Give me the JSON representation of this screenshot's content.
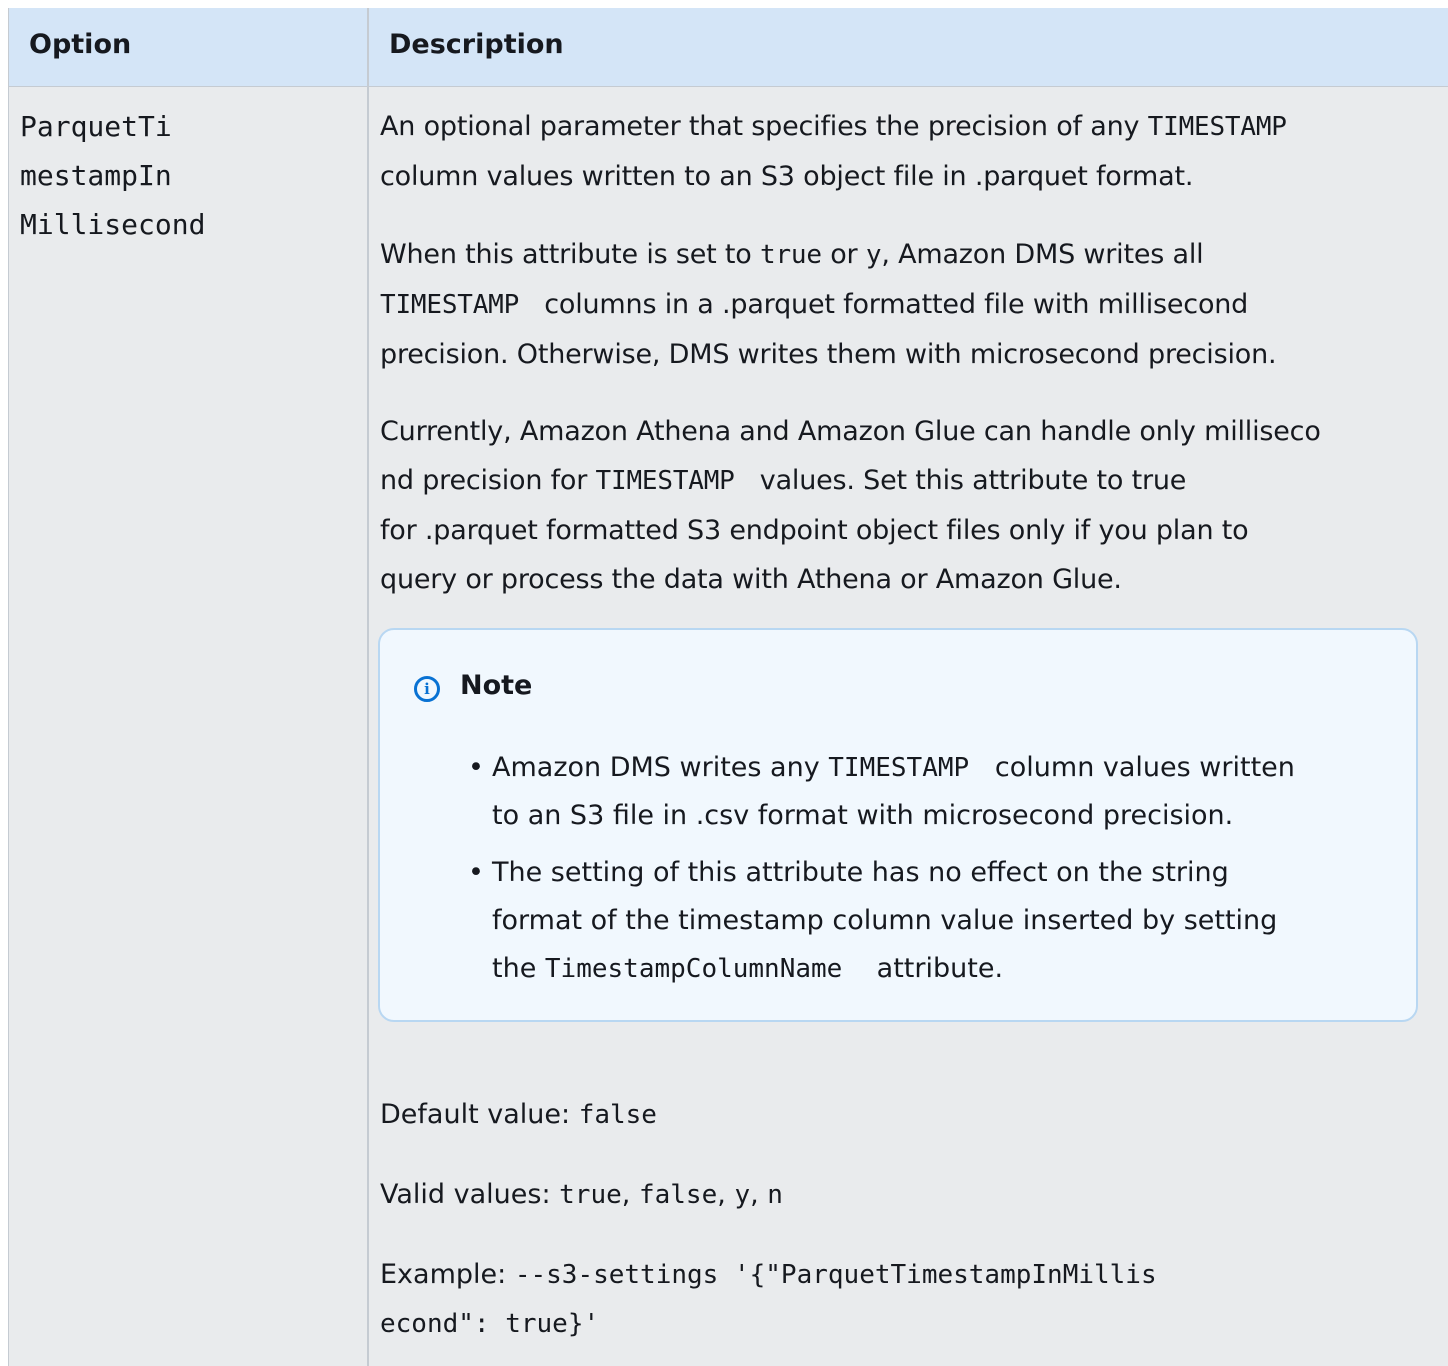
{
  "table": {
    "headers": {
      "option": "Option",
      "description": "Description"
    },
    "row": {
      "option_lines": [
        "ParquetTi",
        "mestampIn",
        "Millisecond"
      ],
      "paragraph1": {
        "line1_text": "An optional parameter that specifies the precision of any",
        "line1_code": "TIMESTAMP",
        "line2_text": "column values written to an S3 object file in .parquet format."
      },
      "paragraph2": {
        "t1": "When this attribute is set to",
        "c1": "true",
        "t2": "or",
        "c2": "y",
        "t3": ", Amazon DMS writes all",
        "c3": "TIMESTAMP",
        "t4": "columns in a .parquet formatted file with millisecond",
        "t5": "precision. Otherwise, DMS writes them with microsecond precision."
      },
      "paragraph3": {
        "l1": "Currently, Amazon Athena and Amazon Glue can handle only milliseco",
        "l2a": "nd precision for",
        "l2c": "TIMESTAMP",
        "l2b": "values. Set this attribute to true",
        "l3": "for .parquet formatted S3 endpoint object files only if you plan to",
        "l4": "query or process the data with Athena or Amazon Glue."
      },
      "note": {
        "icon": "info-icon",
        "title": "Note",
        "items": [
          {
            "a": "Amazon DMS writes any",
            "code": "TIMESTAMP",
            "b": "column values written",
            "c": "to an S3 file in .csv format with microsecond precision."
          },
          {
            "a": "The setting of this attribute has no effect on the string",
            "b": "format of the timestamp column value inserted by setting",
            "c": "the",
            "code": "TimestampColumnName",
            "d": "attribute."
          }
        ]
      },
      "default": {
        "label": "Default value:",
        "value": "false"
      },
      "valid": {
        "label": "Valid values:",
        "v1": "true",
        "v2": "false",
        "v3": "y",
        "v4": "n",
        "sep": ","
      },
      "example": {
        "label": "Example:",
        "line1": "--s3-settings '{\"ParquetTimestampInMillis",
        "line2": "econd\": true}'"
      }
    }
  },
  "colors": {
    "header_bg": "#d4e5f7",
    "row_bg": "#e9ebed",
    "note_bg": "#f1f8fe",
    "note_border": "#b8d7f2",
    "info_blue": "#0972d3"
  }
}
